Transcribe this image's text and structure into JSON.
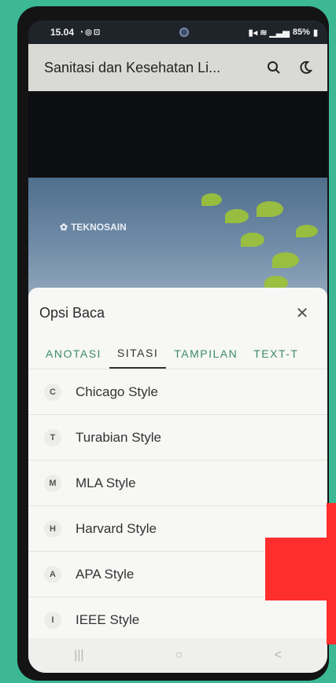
{
  "status_bar": {
    "time": "15.04",
    "notification_icons": [
      "whatsapp-icon",
      "instagram-icon",
      "lock-icon"
    ],
    "right_text": "85%"
  },
  "app_bar": {
    "title": "Sanitasi dan Kesehatan Li..."
  },
  "cover": {
    "brand": "TEKNOSAIN"
  },
  "sheet": {
    "title": "Opsi Baca",
    "tabs": [
      {
        "label": "ANOTASI"
      },
      {
        "label": "SITASI"
      },
      {
        "label": "TAMPILAN"
      },
      {
        "label": "TEXT-T"
      }
    ],
    "items": [
      {
        "badge": "C",
        "label": "Chicago Style"
      },
      {
        "badge": "T",
        "label": "Turabian Style"
      },
      {
        "badge": "M",
        "label": "MLA Style"
      },
      {
        "badge": "H",
        "label": "Harvard Style"
      },
      {
        "badge": "A",
        "label": "APA Style"
      },
      {
        "badge": "I",
        "label": "IEEE Style"
      }
    ]
  },
  "nav_bar": {
    "recents": "|||",
    "home": "○",
    "back": "<"
  },
  "colors": {
    "background": "#3cb894",
    "accent_tab": "#3a8a6a",
    "overlay_arrow": "#ff2e2e"
  }
}
